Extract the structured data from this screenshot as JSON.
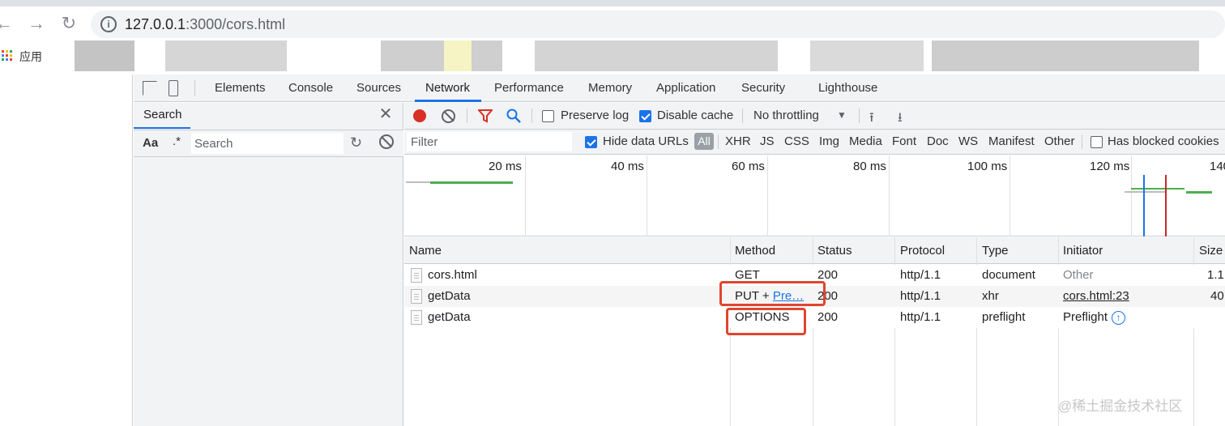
{
  "browser": {
    "url_host": "127.0.0.1",
    "url_rest": ":3000/cors.html",
    "bookmarks_label": "应用"
  },
  "devtools": {
    "tabs": [
      "Elements",
      "Console",
      "Sources",
      "Network",
      "Performance",
      "Memory",
      "Application",
      "Security",
      "Lighthouse"
    ],
    "active_tab": "Network",
    "search_panel": {
      "title": "Search",
      "aa_label": "Aa",
      "regex_label": ".*",
      "input_placeholder": "Search"
    },
    "toolbar": {
      "preserve_log_label": "Preserve log",
      "preserve_log_checked": false,
      "disable_cache_label": "Disable cache",
      "disable_cache_checked": true,
      "throttling_value": "No throttling"
    },
    "filter": {
      "placeholder": "Filter",
      "hide_data_urls_label": "Hide data URLs",
      "hide_data_urls_checked": true,
      "types": [
        "All",
        "XHR",
        "JS",
        "CSS",
        "Img",
        "Media",
        "Font",
        "Doc",
        "WS",
        "Manifest",
        "Other"
      ],
      "active_type": "All",
      "blocked_cookies_label": "Has blocked cookies"
    },
    "overview": {
      "ticks": [
        "20 ms",
        "40 ms",
        "60 ms",
        "80 ms",
        "100 ms",
        "120 ms",
        "140"
      ]
    },
    "table": {
      "columns": [
        "Name",
        "Method",
        "Status",
        "Protocol",
        "Type",
        "Initiator",
        "Size"
      ],
      "rows": [
        {
          "name": "cors.html",
          "method": "GET",
          "method_link": "",
          "status": "200",
          "protocol": "http/1.1",
          "type": "document",
          "initiator": "Other",
          "size": "1.1"
        },
        {
          "name": "getData",
          "method": "PUT + ",
          "method_link": "Pre…",
          "status": "200",
          "protocol": "http/1.1",
          "type": "xhr",
          "initiator": "cors.html:23",
          "size": "40"
        },
        {
          "name": "getData",
          "method": "OPTIONS",
          "method_link": "",
          "status": "200",
          "protocol": "http/1.1",
          "type": "preflight",
          "initiator": "Preflight",
          "size": ""
        }
      ]
    }
  },
  "colors": {
    "accent": "#1a73e8",
    "record": "#d93025",
    "annotation": "#e0452f"
  },
  "watermark": "@稀土掘金技术社区"
}
